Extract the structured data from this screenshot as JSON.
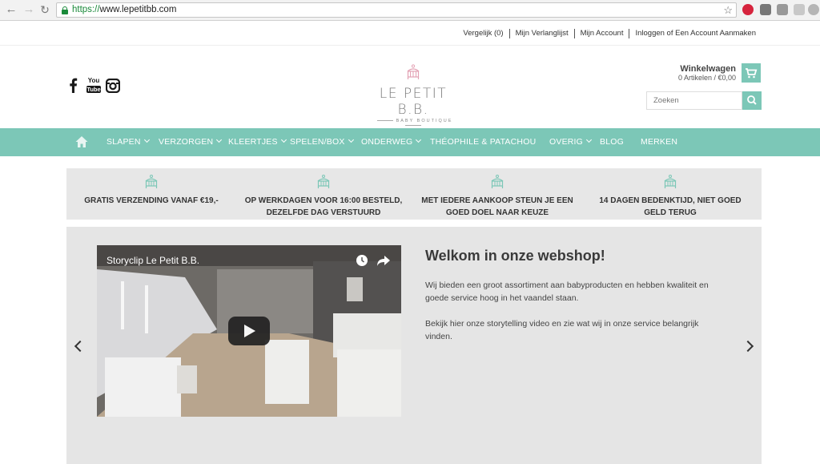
{
  "browser": {
    "url_scheme": "https://",
    "url_rest": "www.lepetitbb.com"
  },
  "toplinks": [
    "Vergelijk (0)",
    "Mijn Verlanglijst",
    "Mijn Account",
    "Inloggen of Een Account Aanmaken"
  ],
  "header": {
    "social_icons": [
      "facebook-icon",
      "youtube-icon",
      "instagram-icon"
    ],
    "youtube_top": "You",
    "youtube_bottom": "Tube",
    "logo_name": "LE PETIT B.B.",
    "logo_sub": "BABY BOUTIQUE",
    "cart_title": "Winkelwagen",
    "cart_sub": "0 Artikelen / €0,00",
    "search_placeholder": "Zoeken"
  },
  "nav": {
    "items": [
      {
        "label": "SLAPEN",
        "dropdown": true
      },
      {
        "label": "VERZORGEN",
        "dropdown": true
      },
      {
        "label": "KLEERTJES",
        "dropdown": true
      },
      {
        "label": "SPELEN/BOX",
        "dropdown": true
      },
      {
        "label": "ONDERWEG",
        "dropdown": true
      },
      {
        "label": "THÉOPHILE & PATACHOU",
        "dropdown": false
      },
      {
        "label": "OVERIG",
        "dropdown": true
      },
      {
        "label": "BLOG",
        "dropdown": false
      },
      {
        "label": "MERKEN",
        "dropdown": false
      }
    ]
  },
  "usps": [
    {
      "line1": "GRATIS VERZENDING VANAF €19,-",
      "line2": ""
    },
    {
      "line1": "OP WERKDAGEN VOOR 16:00 BESTELD,",
      "line2": "DEZELFDE DAG VERSTUURD"
    },
    {
      "line1": "MET IEDERE AANKOOP STEUN JE EEN",
      "line2": "GOED DOEL NAAR KEUZE"
    },
    {
      "line1": "14 DAGEN BEDENKTIJD, NIET GOED",
      "line2": "GELD TERUG"
    }
  ],
  "hero": {
    "video_title": "Storyclip Le Petit B.B.",
    "welcome": "Welkom in onze webshop!",
    "para1_line1": "Wij bieden een groot assortiment aan babyproducten en hebben kwaliteit en",
    "para1_line2": "goede service hoog in het vaandel staan.",
    "para2_line1": "Bekijk hier onze storytelling video en zie wat wij in onze service belangrijk",
    "para2_line2": "vinden."
  },
  "colors": {
    "accent": "#7cc7b7",
    "logo_pink": "#e3a2b4"
  }
}
